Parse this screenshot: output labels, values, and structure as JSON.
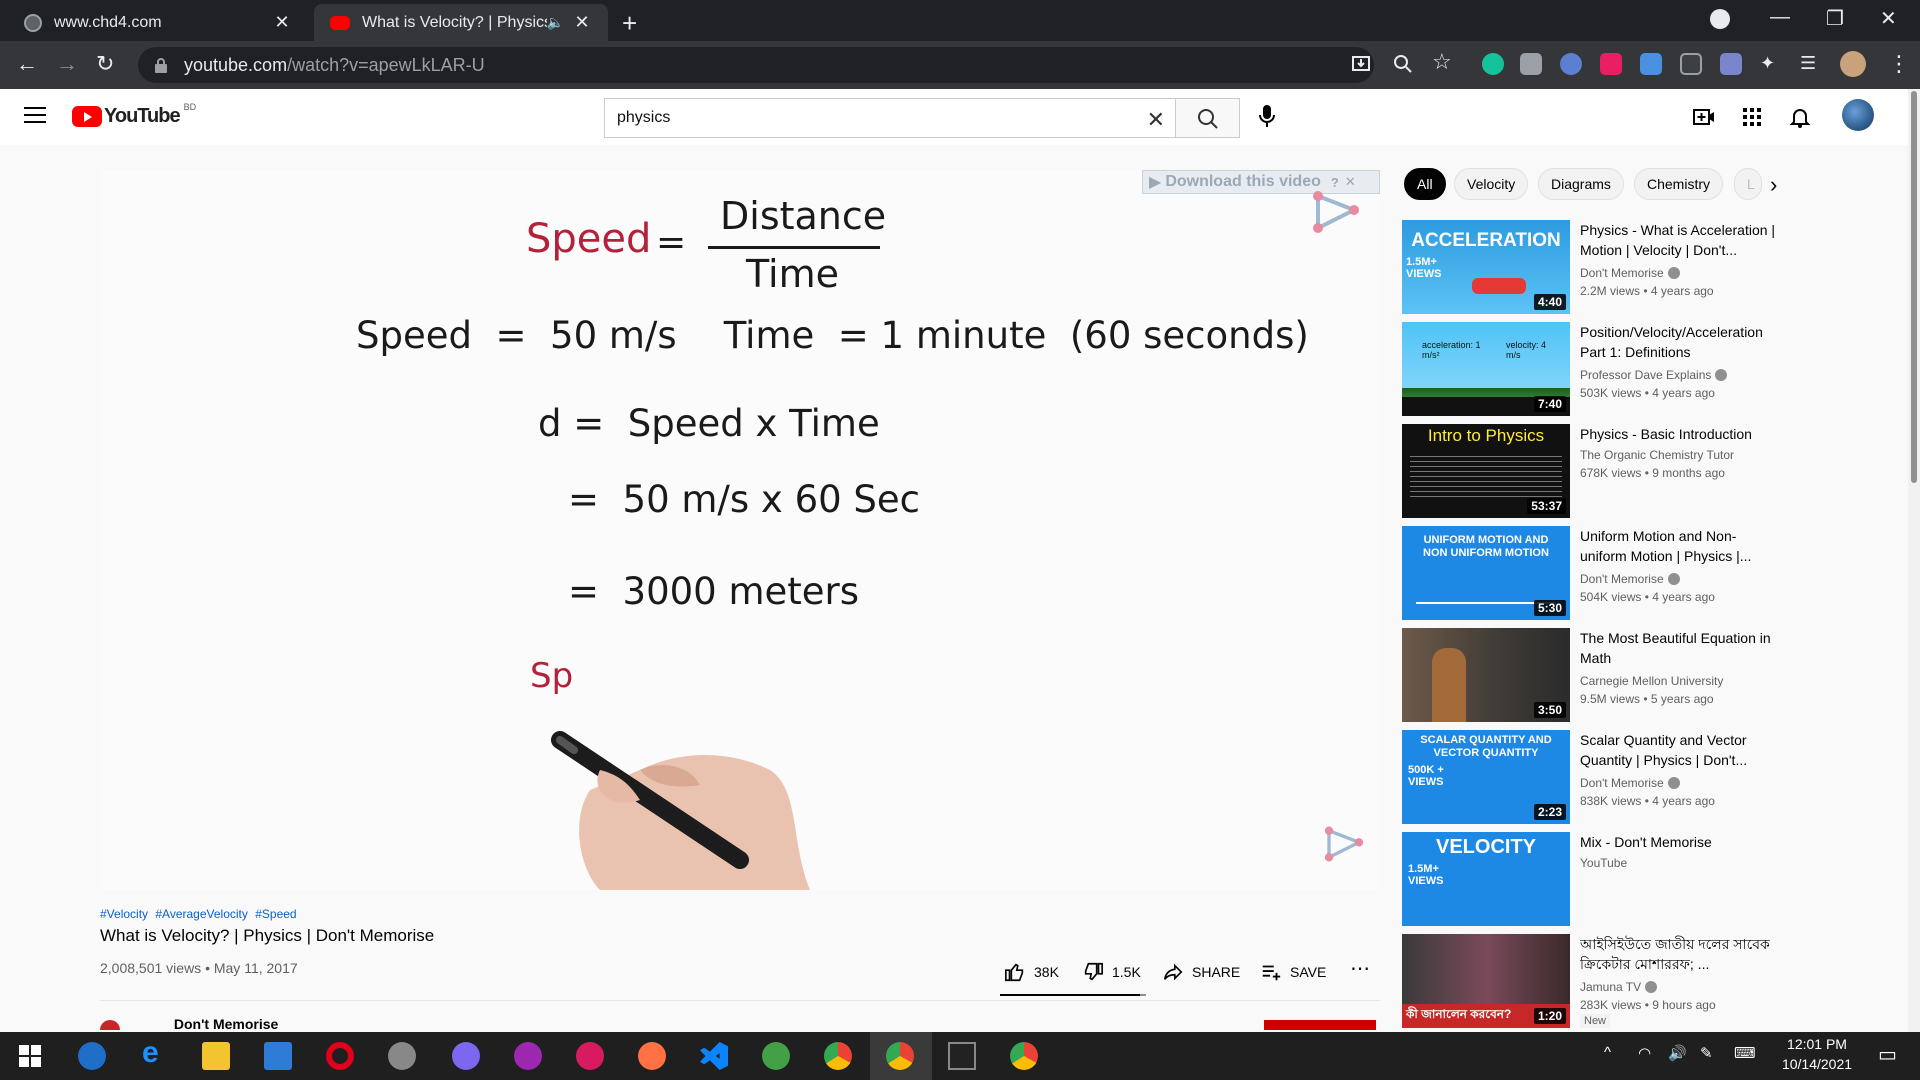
{
  "browser": {
    "tabs": [
      {
        "title": "www.chd4.com",
        "active": false
      },
      {
        "title": "What is Velocity? | Physics | D",
        "active": true
      }
    ],
    "url_host": "youtube.com",
    "url_path": "/watch?v=apewLkLAR-U"
  },
  "youtube": {
    "logo_text": "YouTube",
    "country_code": "BD",
    "search_value": "physics"
  },
  "video_frame": {
    "download_label": "Download this video",
    "line1_speed": "Speed",
    "line1_eq": "=",
    "line1_num": "Distance",
    "line1_den": "Time",
    "line2": "Speed  =  50 m/s    Time  = 1 minute  (60 seconds)",
    "line3": "d =  Speed x Time",
    "line4": "=  50 m/s x 60 Sec",
    "line5": "=  3000 meters",
    "line6": "Sp"
  },
  "video": {
    "hashtags": [
      "#Velocity",
      "#AverageVelocity",
      "#Speed"
    ],
    "title": "What is Velocity? | Physics | Don't Memorise",
    "meta": "2,008,501 views • May 11, 2017",
    "likes": "38K",
    "dislikes": "1.5K",
    "share": "SHARE",
    "save": "SAVE",
    "channel": "Don't Memorise",
    "like_ratio": 0.96
  },
  "chips": [
    "All",
    "Velocity",
    "Diagrams",
    "Chemistry",
    "L"
  ],
  "recommendations": [
    {
      "title": "Physics - What is Acceleration | Motion | Velocity | Don't...",
      "channel": "Don't Memorise",
      "verified": true,
      "views": "2.2M views • 4 years ago",
      "duration": "4:40",
      "thumb_text": "ACCELERATION",
      "thumb_sub": "1.5M+ VIEWS"
    },
    {
      "title": "Position/Velocity/Acceleration Part 1: Definitions",
      "channel": "Professor Dave Explains",
      "verified": true,
      "views": "503K views • 4 years ago",
      "duration": "7:40",
      "thumb_text": "acceleration: 1 m/s²",
      "thumb_sub": "velocity: 4 m/s"
    },
    {
      "title": "Physics - Basic Introduction",
      "channel": "The Organic Chemistry Tutor",
      "verified": false,
      "views": "678K views • 9 months ago",
      "duration": "53:37",
      "thumb_text": "Intro to Physics",
      "thumb_sub": ""
    },
    {
      "title": "Uniform Motion and Non-uniform Motion | Physics |...",
      "channel": "Don't Memorise",
      "verified": true,
      "views": "504K views • 4 years ago",
      "duration": "5:30",
      "thumb_text": "UNIFORM MOTION AND NON UNIFORM MOTION",
      "thumb_sub": ""
    },
    {
      "title": "The Most Beautiful Equation in Math",
      "channel": "Carnegie Mellon University",
      "verified": false,
      "views": "9.5M views • 5 years ago",
      "duration": "3:50",
      "thumb_text": "",
      "thumb_sub": ""
    },
    {
      "title": "Scalar Quantity and Vector Quantity | Physics | Don't...",
      "channel": "Don't Memorise",
      "verified": true,
      "views": "838K views • 4 years ago",
      "duration": "2:23",
      "thumb_text": "SCALAR QUANTITY AND VECTOR QUANTITY",
      "thumb_sub": "500K + VIEWS"
    },
    {
      "title": "Mix - Don't Memorise",
      "channel": "YouTube",
      "verified": false,
      "views": "",
      "duration": "",
      "thumb_text": "VELOCITY",
      "thumb_sub": "1.5M+ VIEWS"
    },
    {
      "title": "আইসিইউতে জাতীয় দলের সাবেক ক্রিকেটার মোশাররফ; ...",
      "channel": "Jamuna TV",
      "verified": true,
      "views": "283K views • 9 hours ago",
      "duration": "1:20",
      "badge": "New",
      "thumb_text": "কী জানালেন করবেন?",
      "thumb_sub": ""
    }
  ],
  "taskbar": {
    "time": "12:01 PM",
    "date": "10/14/2021"
  }
}
